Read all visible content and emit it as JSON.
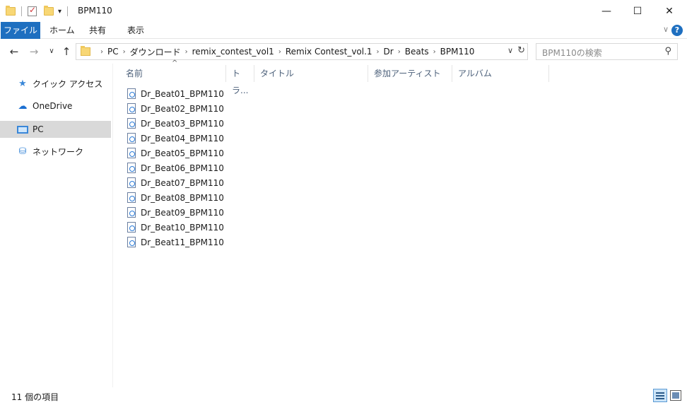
{
  "window": {
    "title": "BPM110",
    "minimize_glyph": "—",
    "maximize_glyph": "☐",
    "close_glyph": "✕"
  },
  "ribbon": {
    "tabs": [
      "ファイル",
      "ホーム",
      "共有",
      "表示"
    ],
    "expand_glyph": "∨",
    "help_glyph": "?"
  },
  "nav": {
    "back_glyph": "←",
    "forward_glyph": "→",
    "recent_glyph": "∨",
    "up_glyph": "↑"
  },
  "address": {
    "breadcrumbs": [
      "PC",
      "ダウンロード",
      "remix_contest_vol1",
      "Remix Contest_vol.1",
      "Dr",
      "Beats",
      "BPM110"
    ],
    "separator": "›",
    "dropdown_glyph": "∨",
    "refresh_glyph": "↻"
  },
  "search": {
    "placeholder": "BPM110の検索",
    "icon": "search-icon",
    "glyph": "⚲"
  },
  "sidebar": {
    "items": [
      {
        "label": "クイック アクセス",
        "icon": "star-icon",
        "glyph": "★"
      },
      {
        "label": "OneDrive",
        "icon": "cloud-icon",
        "glyph": "☁"
      },
      {
        "label": "PC",
        "icon": "computer-icon",
        "selected": true
      },
      {
        "label": "ネットワーク",
        "icon": "network-icon",
        "glyph": "⛁"
      }
    ]
  },
  "columns": {
    "name": "名前",
    "track": "トラ...",
    "title": "タイトル",
    "artist": "参加アーティスト",
    "album": "アルバム",
    "sort_glyph": "^"
  },
  "files": [
    "Dr_Beat01_BPM110",
    "Dr_Beat02_BPM110",
    "Dr_Beat03_BPM110",
    "Dr_Beat04_BPM110",
    "Dr_Beat05_BPM110",
    "Dr_Beat06_BPM110",
    "Dr_Beat07_BPM110",
    "Dr_Beat08_BPM110",
    "Dr_Beat09_BPM110",
    "Dr_Beat10_BPM110",
    "Dr_Beat11_BPM110"
  ],
  "statusbar": {
    "item_count": "11 個の項目"
  },
  "colors": {
    "accent": "#1e6fc0",
    "selected_bg": "#d9d9d9",
    "folder": "#f8d775"
  }
}
